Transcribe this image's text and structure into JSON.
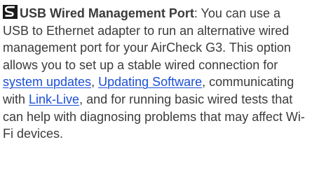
{
  "icon": "usb-port-icon",
  "term": "USB Wired Management Port",
  "seg1": ": You can use a USB to Ethernet adapter to run an alternative wired management port for your AirCheck G3. This option allows you to set up a stable wired connection for ",
  "link1": "system updates",
  "sep1": ", ",
  "link2": "Updating Software",
  "seg2": ", communicating with ",
  "link3": "Link-Live",
  "seg3": ", and for running basic wired tests that can help with diagnosing problems that may affect Wi-Fi devices.",
  "colors": {
    "text": "#3b3b3b",
    "link": "#1a4fd6",
    "icon": "#1a1a1a"
  }
}
